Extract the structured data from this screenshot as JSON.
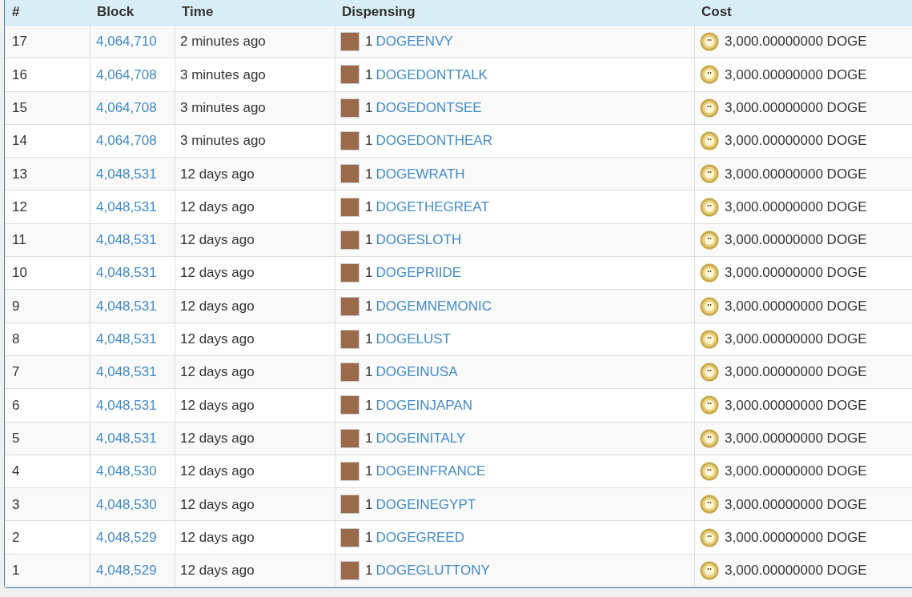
{
  "table": {
    "columns": [
      "#",
      "Block",
      "Time",
      "Dispensing",
      "Cost"
    ],
    "rows": [
      {
        "number": "17",
        "block": "4,064,710",
        "time": "2 minutes ago",
        "quantity": "1",
        "asset": "DOGEENVY",
        "cost": "3,000.00000000 DOGE"
      },
      {
        "number": "16",
        "block": "4,064,708",
        "time": "3 minutes ago",
        "quantity": "1",
        "asset": "DOGEDONTTALK",
        "cost": "3,000.00000000 DOGE"
      },
      {
        "number": "15",
        "block": "4,064,708",
        "time": "3 minutes ago",
        "quantity": "1",
        "asset": "DOGEDONTSEE",
        "cost": "3,000.00000000 DOGE"
      },
      {
        "number": "14",
        "block": "4,064,708",
        "time": "3 minutes ago",
        "quantity": "1",
        "asset": "DOGEDONTHEAR",
        "cost": "3,000.00000000 DOGE"
      },
      {
        "number": "13",
        "block": "4,048,531",
        "time": "12 days ago",
        "quantity": "1",
        "asset": "DOGEWRATH",
        "cost": "3,000.00000000 DOGE"
      },
      {
        "number": "12",
        "block": "4,048,531",
        "time": "12 days ago",
        "quantity": "1",
        "asset": "DOGETHEGREAT",
        "cost": "3,000.00000000 DOGE"
      },
      {
        "number": "11",
        "block": "4,048,531",
        "time": "12 days ago",
        "quantity": "1",
        "asset": "DOGESLOTH",
        "cost": "3,000.00000000 DOGE"
      },
      {
        "number": "10",
        "block": "4,048,531",
        "time": "12 days ago",
        "quantity": "1",
        "asset": "DOGEPRIIDE",
        "cost": "3,000.00000000 DOGE"
      },
      {
        "number": "9",
        "block": "4,048,531",
        "time": "12 days ago",
        "quantity": "1",
        "asset": "DOGEMNEMONIC",
        "cost": "3,000.00000000 DOGE"
      },
      {
        "number": "8",
        "block": "4,048,531",
        "time": "12 days ago",
        "quantity": "1",
        "asset": "DOGELUST",
        "cost": "3,000.00000000 DOGE"
      },
      {
        "number": "7",
        "block": "4,048,531",
        "time": "12 days ago",
        "quantity": "1",
        "asset": "DOGEINUSA",
        "cost": "3,000.00000000 DOGE"
      },
      {
        "number": "6",
        "block": "4,048,531",
        "time": "12 days ago",
        "quantity": "1",
        "asset": "DOGEINJAPAN",
        "cost": "3,000.00000000 DOGE"
      },
      {
        "number": "5",
        "block": "4,048,531",
        "time": "12 days ago",
        "quantity": "1",
        "asset": "DOGEINITALY",
        "cost": "3,000.00000000 DOGE"
      },
      {
        "number": "4",
        "block": "4,048,530",
        "time": "12 days ago",
        "quantity": "1",
        "asset": "DOGEINFRANCE",
        "cost": "3,000.00000000 DOGE"
      },
      {
        "number": "3",
        "block": "4,048,530",
        "time": "12 days ago",
        "quantity": "1",
        "asset": "DOGEINEGYPT",
        "cost": "3,000.00000000 DOGE"
      },
      {
        "number": "2",
        "block": "4,048,529",
        "time": "12 days ago",
        "quantity": "1",
        "asset": "DOGEGREED",
        "cost": "3,000.00000000 DOGE"
      },
      {
        "number": "1",
        "block": "4,048,529",
        "time": "12 days ago",
        "quantity": "1",
        "asset": "DOGEGLUTTONY",
        "cost": "3,000.00000000 DOGE"
      }
    ]
  }
}
